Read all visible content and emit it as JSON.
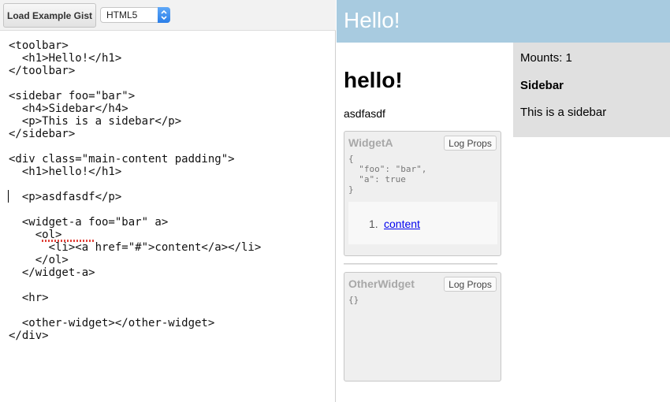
{
  "editor": {
    "toolbar": {
      "gist_button_label": "Load Example Gist",
      "mode_select_value": "HTML5"
    },
    "code_lines": [
      "<toolbar>",
      "  <h1>Hello!</h1>",
      "</toolbar>",
      "",
      "<sidebar foo=\"bar\">",
      "  <h4>Sidebar</h4>",
      "  <p>This is a sidebar</p>",
      "</sidebar>",
      "",
      "<div class=\"main-content padding\">",
      "  <h1>hello!</h1>",
      "",
      "  <p>asdfasdf</p>",
      "",
      "  <widget-a foo=\"bar\" a>",
      "    <ol>",
      "      <li><a href=\"#\">content</a></li>",
      "    </ol>",
      "  </widget-a>",
      "",
      "  <hr>",
      "",
      "  <other-widget></other-widget>",
      "</div>"
    ]
  },
  "preview": {
    "toolbar": {
      "title": "Hello!"
    },
    "sidebar": {
      "mounts": "Mounts: 1",
      "heading": "Sidebar",
      "text": "This is a sidebar"
    },
    "main": {
      "heading": "hello!",
      "paragraph": "asdfasdf",
      "widget_a": {
        "name": "WidgetA",
        "log_button_label": "Log Props",
        "props_lines": [
          "{",
          "  \"foo\": \"bar\",",
          "  \"a\": true",
          "}"
        ],
        "list_number": "1.",
        "link_text": "content"
      },
      "other_widget": {
        "name": "OtherWidget",
        "log_button_label": "Log Props",
        "props_lines": [
          "{}"
        ]
      }
    }
  },
  "colors": {
    "preview_toolbar": "#a8cbe0",
    "sidebar_bg": "#e0e0e0",
    "widget_bg": "#efefef",
    "link": "#0000ee",
    "select_arrow": "#2a7ee8"
  },
  "icons": {
    "select_arrows": "chevron-up-down-icon",
    "spellcheck": "spellcheck-underline"
  }
}
